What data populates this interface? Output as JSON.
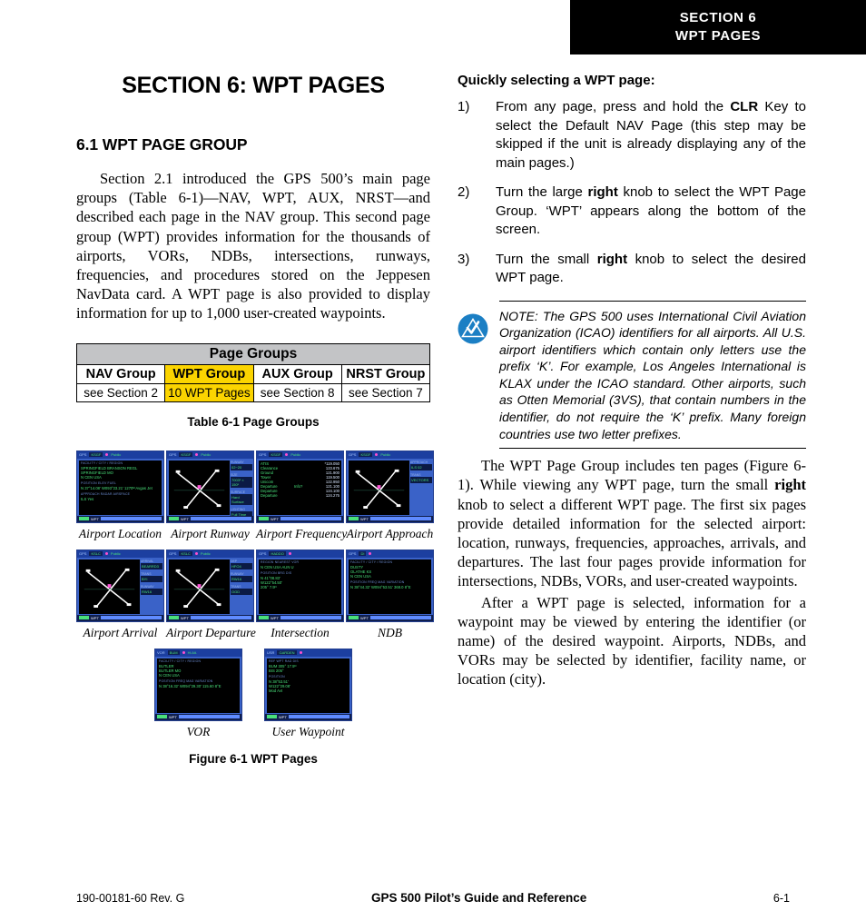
{
  "header": {
    "line1": "SECTION 6",
    "line2": "WPT PAGES"
  },
  "page_title": "SECTION 6:  WPT PAGES",
  "section_heading": "6.1  WPT PAGE GROUP",
  "left_paragraph": "Section 2.1 introduced the GPS 500’s main page groups (Table 6-1)—NAV, WPT, AUX, NRST—and described each page in the NAV group.  This second page group (WPT) provides information for the thousands of airports, VORs, NDBs, intersections, runways, frequencies, and procedures stored on the Jeppesen NavData card.  A WPT page is also provided to display information for up to 1,000 user-created waypoints.",
  "table": {
    "title": "Page Groups",
    "headers": [
      "NAV Group",
      "WPT Group",
      "AUX Group",
      "NRST Group"
    ],
    "cells": [
      "see Section 2",
      "10 WPT Pages",
      "see Section 8",
      "see Section 7"
    ],
    "highlight_index": 1,
    "highlight_color": "#FBD400",
    "title_bg": "#C3C4C6",
    "caption": "Table 6-1  Page Groups"
  },
  "procedure": {
    "title": "Quickly selecting a WPT page:",
    "steps": [
      {
        "num": "1)",
        "parts": [
          {
            "t": "From any page, press and hold the ",
            "b": false
          },
          {
            "t": "CLR",
            "b": true
          },
          {
            "t": " Key to select the Default NAV Page (this step may be skipped if the unit is already displaying any of the main pages.)",
            "b": false
          }
        ]
      },
      {
        "num": "2)",
        "parts": [
          {
            "t": "Turn the large ",
            "b": false
          },
          {
            "t": "right",
            "b": true
          },
          {
            "t": " knob to select the WPT Page Group.  ‘WPT’ appears along the bottom of the screen.",
            "b": false
          }
        ]
      },
      {
        "num": "3)",
        "parts": [
          {
            "t": "Turn the small ",
            "b": false
          },
          {
            "t": "right",
            "b": true
          },
          {
            "t": " knob to select the desired WPT page.",
            "b": false
          }
        ]
      }
    ]
  },
  "note": {
    "icon_name": "garmin-note-icon",
    "icon_color": "#1B7FC4",
    "text": "NOTE:  The GPS 500 uses International Civil Aviation Organization (ICAO) identifiers for all airports. All U.S. airport identifiers which contain only letters use the prefix ‘K’.  For example, Los Angeles International is KLAX under the ICAO standard.  Other airports, such as Otten Memorial (3VS), that contain numbers in the identifier, do not require the ‘K’ prefix.  Many foreign countries use two letter prefixes."
  },
  "right_paragraphs": {
    "p1_a": "The WPT Page Group includes ten pages (Figure 6-1).  While viewing any WPT page, turn the small ",
    "p1_bold": "right",
    "p1_b": " knob to select a different WPT page.  The first six pages provide detailed information for the selected airport: location, runways, frequencies, approaches, arrivals, and departures.  The last four pages provide information for intersections, NDBs, VORs, and user-created waypoints.",
    "p2": "After a WPT page is selected, information for a waypoint may be viewed by entering the identifier (or name) of the desired waypoint.  Airports, NDBs, and VORs may be selected by identifier, facility name, or location (city)."
  },
  "figure": {
    "caption": "Figure 6-1  WPT Pages",
    "rows": [
      [
        {
          "caption": "Airport Location",
          "type": "list",
          "topbar": {
            "unit": "GPS",
            "ident": "KSGF",
            "label": "Public"
          },
          "hdr1": "FACILITY / CITY / REGION",
          "lines": [
            "SPRINGFIELD BRANSON REGL",
            "SPRINGFIELD MO",
            "N CEN USA"
          ],
          "hdr2": [
            "POSITION",
            "ELEV",
            "FUEL"
          ],
          "row2": [
            "N 37°14.08' W093°23.21'",
            "1270ᴹ",
            "Avgas Jet"
          ],
          "hdr3": [
            "APPROACH",
            "RADAR",
            "AIRSPACE"
          ],
          "row3": [
            "ILS",
            "Yes",
            ""
          ]
        },
        {
          "caption": "Airport Runway",
          "type": "map-side",
          "topbar": {
            "unit": "GPS",
            "ident": "KSGF",
            "label": "Public"
          },
          "side": [
            {
              "label": "RUNWAY",
              "value": "02−20"
            },
            {
              "label": "SIZE",
              "value": "7003ˢ × 150ˢ"
            },
            {
              "label": "SURFACE",
              "value": "Hard Surface"
            },
            {
              "label": "LIGHTING",
              "value": "Full Time"
            }
          ]
        },
        {
          "caption": "Airport Frequency",
          "type": "freq",
          "topbar": {
            "unit": "GPS",
            "ident": "KSGF",
            "label": "Public"
          },
          "freqs": [
            {
              "name": "ATIS",
              "extra": "",
              "value": "*119.050"
            },
            {
              "name": "Clearance",
              "extra": "",
              "value": "123.675"
            },
            {
              "name": "Ground",
              "extra": "",
              "value": "121.900"
            },
            {
              "name": "Tower",
              "extra": "",
              "value": "119.500"
            },
            {
              "name": "Unicom",
              "extra": "",
              "value": "122.950"
            },
            {
              "name": "Departure",
              "extra": "Info?",
              "value": "121.100"
            },
            {
              "name": "Departure",
              "extra": "",
              "value": "124.100"
            },
            {
              "name": "Departure",
              "extra": "",
              "value": "124.275"
            }
          ]
        },
        {
          "caption": "Airport Approach",
          "type": "map-side",
          "topbar": {
            "unit": "GPS",
            "ident": "KSGF",
            "label": "Public"
          },
          "side": [
            {
              "label": "APPROACH",
              "value": "ILS 02"
            },
            {
              "label": "TRANS",
              "value": "VECTORS"
            }
          ]
        }
      ],
      [
        {
          "caption": "Airport Arrival",
          "type": "map-side",
          "topbar": {
            "unit": "GPS",
            "ident": "KSLC",
            "label": "Public"
          },
          "side": [
            {
              "label": "ARRIVAL",
              "value": "BEARRD3"
            },
            {
              "label": "TRANS",
              "value": "BYI"
            },
            {
              "label": "RUNWAY",
              "value": "RW16"
            }
          ]
        },
        {
          "caption": "Airport Departure",
          "type": "map-side",
          "topbar": {
            "unit": "GPS",
            "ident": "KSLC",
            "label": "Public"
          },
          "side": [
            {
              "label": "DEP",
              "value": "HFO4"
            },
            {
              "label": "RUNWAY",
              "value": "RW16"
            },
            {
              "label": "TRANS",
              "value": "OGD"
            }
          ]
        },
        {
          "caption": "Intersection",
          "type": "intersection",
          "topbar": {
            "unit": "GPS",
            "ident": "HADDO",
            "label": ""
          },
          "hdrs": [
            "REGION",
            "NEAREST VOR"
          ],
          "region": "N CEN USA",
          "vor": "AUN  U",
          "pos_hdr": "POSITION",
          "pos": [
            "N 41°08.83'",
            "W122°54.50'"
          ],
          "brg_hdr": [
            "BRG",
            "DIS"
          ],
          "brg": [
            "205°",
            "7.5ᴺ"
          ]
        },
        {
          "caption": "NDB",
          "type": "list",
          "topbar": {
            "unit": "GPS",
            "ident": "DI",
            "label": ""
          },
          "hdr1": "FACILITY / CITY / REGION",
          "lines": [
            "DUSTY",
            "OLATHE KS",
            "N CEN USA"
          ],
          "hdr2": [
            "POSITION",
            "FREQ",
            "MAG VARIATION"
          ],
          "row2": [
            "N 38°44.32' W094°53.51'",
            "368.0",
            "8°E"
          ],
          "hdr3": [],
          "row3": []
        }
      ],
      [
        {
          "caption": "VOR",
          "type": "list",
          "topbar": {
            "unit": "VOR",
            "ident": "BUM",
            "label": "Hi Alt."
          },
          "hdr1": "FACILITY / CITY / REGION",
          "lines": [
            "BUTLER",
            "BUTLER MO",
            "N CEN USA"
          ],
          "hdr2": [
            "POSITION",
            "FREQ",
            "MAG VARIATION"
          ],
          "row2": [
            "N 38°16.32' W094°29.30'",
            "115.60",
            "8°E"
          ],
          "hdr3": [],
          "row3": []
        },
        {
          "caption": "User Waypoint",
          "type": "user",
          "topbar": {
            "unit": "USR",
            "ident": "GARDEN",
            "label": ""
          },
          "hdrs": [
            "REF WPT",
            "RAD",
            "DIS"
          ],
          "rows": [
            [
              "BUM",
              "305°",
              "17.5ᴺ"
            ],
            [
              "BIS",
              "205°",
              ""
            ]
          ],
          "pos_hdr": "POSITION",
          "pos": [
            "N 38°53.51'",
            "W122°29.08'"
          ],
          "note": "Mod Avt"
        }
      ]
    ]
  },
  "footer": {
    "left": "190-00181-60  Rev. G",
    "center": "GPS 500 Pilot’s Guide and Reference",
    "right": "6-1"
  }
}
